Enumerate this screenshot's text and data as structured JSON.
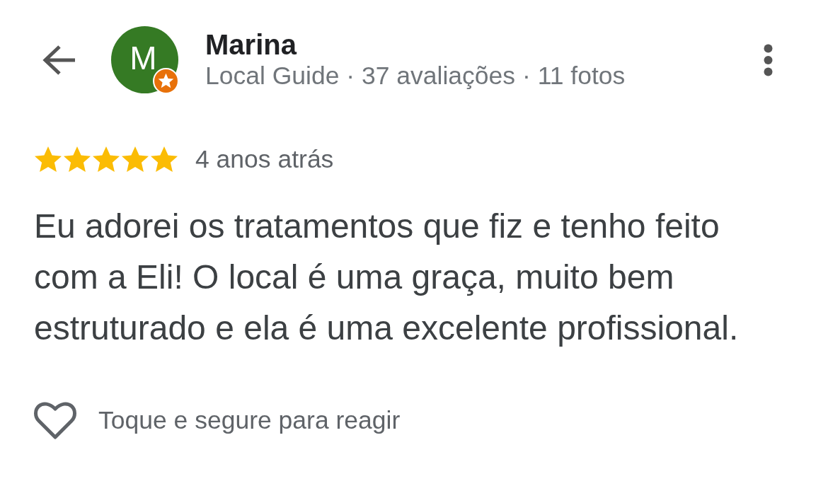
{
  "header": {
    "reviewer": {
      "name": "Marina",
      "initial": "M",
      "local_guide": true,
      "stats": "Local Guide · 37 avaliações · 11 fotos"
    }
  },
  "review": {
    "stars": 5,
    "time": "4 anos atrás",
    "text": "Eu adorei os tratamentos que fiz e tenho feito com a Eli! O local é uma graça, muito bem estruturado e ela é uma excelente profissional."
  },
  "reaction": {
    "liked": false,
    "hint": "Toque e segure para reagir"
  }
}
